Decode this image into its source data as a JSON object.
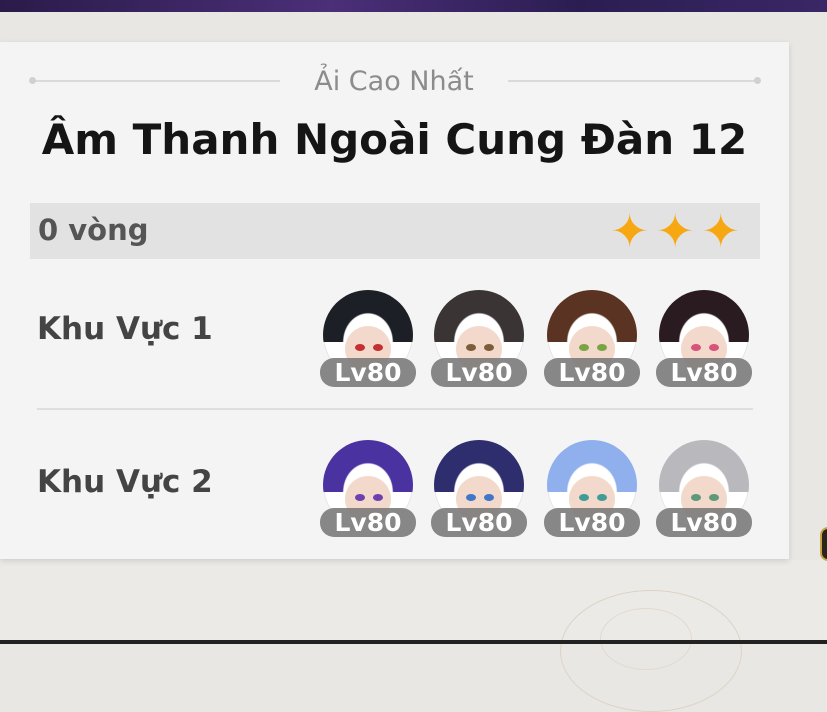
{
  "header": {
    "label": "Ải Cao Nhất"
  },
  "stage": {
    "title": "Âm Thanh Ngoài Cung Đàn 12"
  },
  "rounds": {
    "text": "0 vòng",
    "stars": 3
  },
  "colors": {
    "star": "#f6a712",
    "card": "#f4f4f4",
    "level_badge": "#787878"
  },
  "zones": [
    {
      "label": "Khu Vực 1",
      "characters": [
        {
          "level": "Lv80",
          "hair": "#1d1f26",
          "eye": "#c4302f"
        },
        {
          "level": "Lv80",
          "hair": "#3a3434",
          "eye": "#7c5d3a"
        },
        {
          "level": "Lv80",
          "hair": "#5a3322",
          "eye": "#7aa343"
        },
        {
          "level": "Lv80",
          "hair": "#2a1b21",
          "eye": "#d8527a"
        }
      ]
    },
    {
      "label": "Khu Vực 2",
      "characters": [
        {
          "level": "Lv80",
          "hair": "#4a32a0",
          "eye": "#6e3fb0"
        },
        {
          "level": "Lv80",
          "hair": "#2e2d6e",
          "eye": "#3f76c9"
        },
        {
          "level": "Lv80",
          "hair": "#8fb0ec",
          "eye": "#3f9d98"
        },
        {
          "level": "Lv80",
          "hair": "#b9b9bd",
          "eye": "#5f9a78"
        }
      ]
    }
  ]
}
